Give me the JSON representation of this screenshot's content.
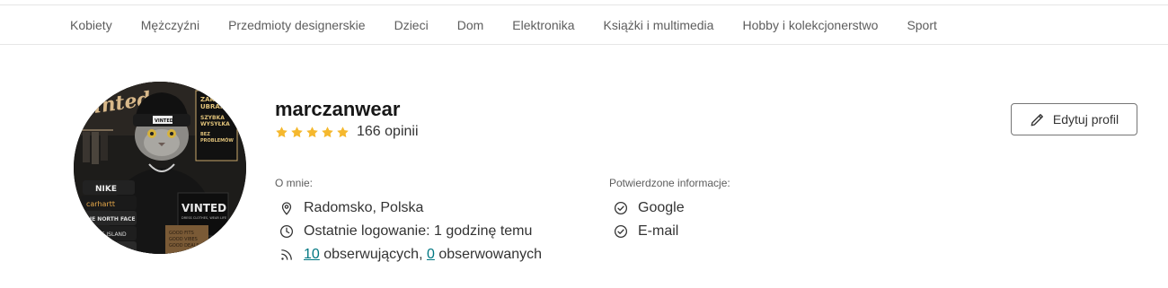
{
  "nav": {
    "items": [
      {
        "label": "Kobiety"
      },
      {
        "label": "Mężczyźni"
      },
      {
        "label": "Przedmioty designerskie"
      },
      {
        "label": "Dzieci"
      },
      {
        "label": "Dom"
      },
      {
        "label": "Elektronika"
      },
      {
        "label": "Książki i multimedia"
      },
      {
        "label": "Hobby i kolekcjonerstwo"
      },
      {
        "label": "Sport"
      }
    ]
  },
  "profile": {
    "username": "marczanwear",
    "rating": 5,
    "reviews_label": "166 opinii",
    "edit_button_label": "Edytuj profil",
    "avatar_text": {
      "wall_sign": "Vinted",
      "beanie": "VINTED",
      "bag": "VINTED",
      "bag_slogan": "DRESS CLOTHES, WEAR LIFE",
      "sweater_brands": [
        "NIKE",
        "carhartt",
        "THE NORTH FACE",
        "STONE ISLAND"
      ],
      "poster_lines": [
        "ZAKŁ",
        "UBRAŃ",
        "SZYBKA",
        "WYSYŁKA",
        "BEZ",
        "PROBLEMÓW"
      ],
      "box_lines": [
        "GOOD FITS",
        "GOOD VIBES",
        "GOOD DEALS"
      ]
    }
  },
  "about": {
    "title": "O mnie:",
    "location": "Radomsko, Polska",
    "last_login": "Ostatnie logowanie: 1 godzinę temu",
    "followers_count": "10",
    "followers_text": " obserwujących, ",
    "following_count": "0",
    "following_text": " obserwowanych"
  },
  "verified": {
    "title": "Potwierdzone informacje:",
    "items": [
      {
        "label": "Google"
      },
      {
        "label": "E-mail"
      }
    ]
  },
  "colors": {
    "star": "#f5b82e",
    "link": "#007782",
    "border": "#757575"
  },
  "icons": {
    "location": "location-pin-icon",
    "clock": "clock-icon",
    "followers": "rss-icon",
    "check": "check-circle-icon",
    "edit": "pencil-icon"
  }
}
